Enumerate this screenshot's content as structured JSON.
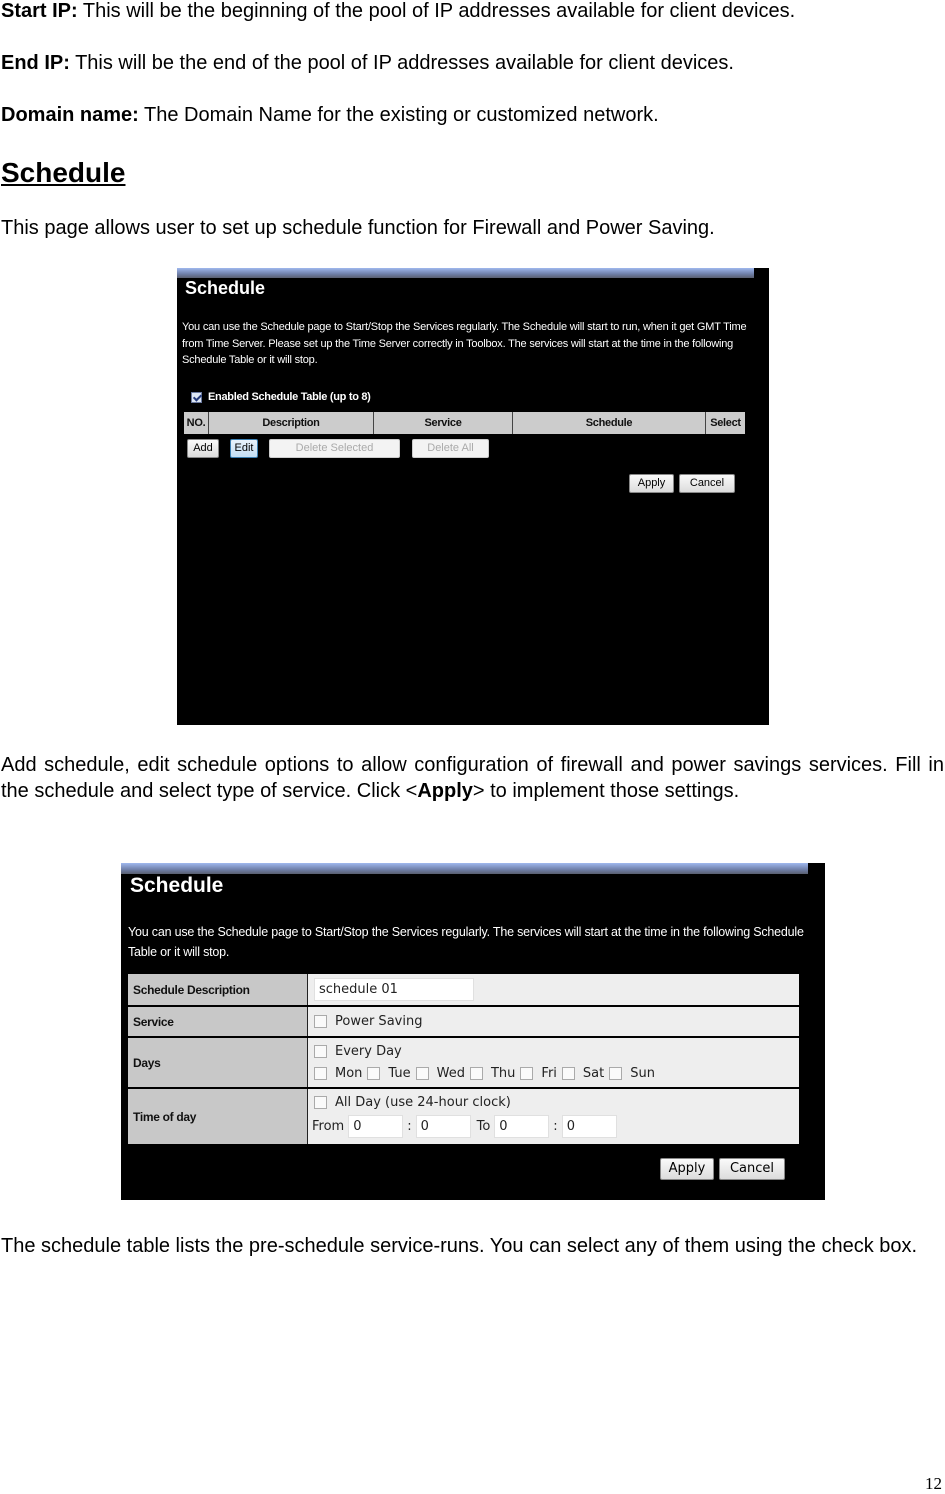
{
  "intro": [
    {
      "label": "Start IP:",
      "text": " This will be the beginning of the pool of IP addresses available for client devices."
    },
    {
      "label": "End IP:",
      "text": " This will be the end of the pool of IP addresses available for client devices."
    },
    {
      "label": "Domain name:",
      "text": " The Domain Name for the existing or customized network."
    }
  ],
  "section_heading": "Schedule",
  "section_intro": "This page allows user to set up schedule function for Firewall and Power Saving.",
  "screenshot1": {
    "title": "Schedule",
    "description": "You can use the Schedule page to Start/Stop the Services regularly. The Schedule will start to run, when it get GMT Time from Time Server. Please set up the Time Server correctly in Toolbox. The services will start at the time in the following Schedule Table or it will stop.",
    "enable_label": "Enabled Schedule Table (up to 8)",
    "enable_checked": true,
    "columns": [
      "NO.",
      "Description",
      "Service",
      "Schedule",
      "Select"
    ],
    "buttons": {
      "add": "Add",
      "edit": "Edit",
      "delete_selected": "Delete Selected",
      "delete_all": "Delete All",
      "apply": "Apply",
      "cancel": "Cancel"
    }
  },
  "paragraph2_pre": "Add schedule, edit schedule options to allow configuration of firewall and power savings services. Fill in the schedule and select type of service. Click <",
  "paragraph2_bold": "Apply",
  "paragraph2_post": "> to implement those settings.",
  "screenshot2": {
    "title": "Schedule",
    "description": "You can use the Schedule page to Start/Stop the Services regularly. The services will start at the time in the following Schedule Table or it will stop.",
    "rows": {
      "description_label": "Schedule Description",
      "description_value": "schedule 01",
      "service_label": "Service",
      "service_option": "Power Saving",
      "days_label": "Days",
      "every_day": "Every Day",
      "days": [
        "Mon",
        "Tue",
        "Wed",
        "Thu",
        "Fri",
        "Sat",
        "Sun"
      ],
      "time_label": "Time of day",
      "all_day": "All Day (use 24-hour clock)",
      "from_label": "From",
      "to_label": "To",
      "separator": ":",
      "from_hour": "0",
      "from_minute": "0",
      "to_hour": "0",
      "to_minute": "0"
    },
    "buttons": {
      "apply": "Apply",
      "cancel": "Cancel"
    }
  },
  "closing": "The schedule table lists the pre-schedule service-runs. You can select any of them using the check box.",
  "page_number": "12"
}
